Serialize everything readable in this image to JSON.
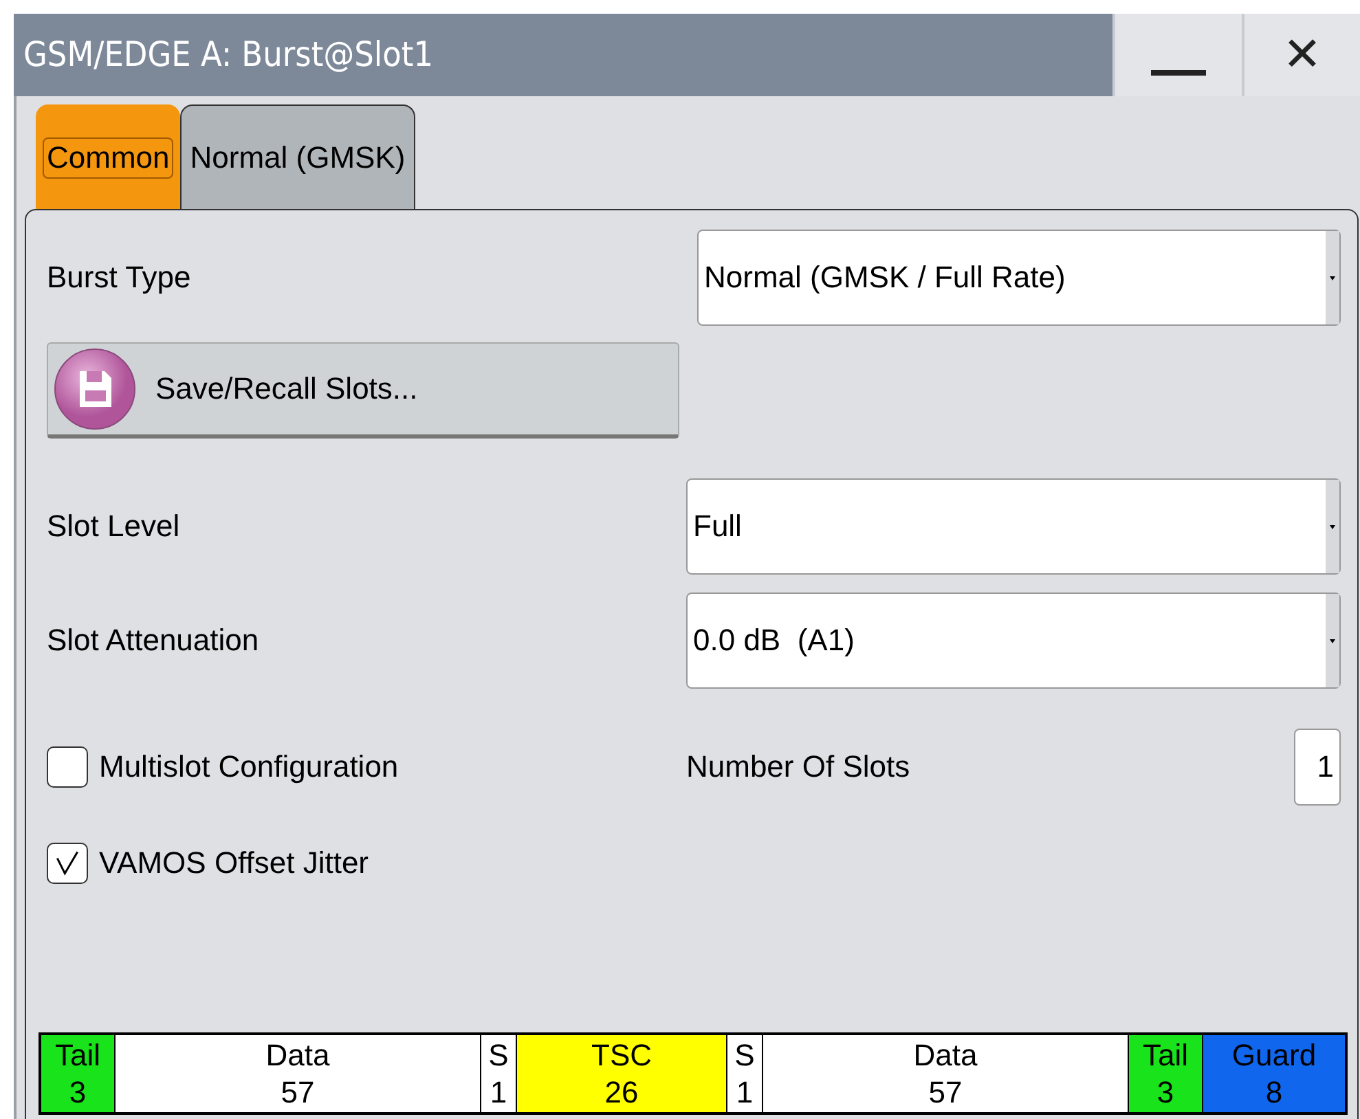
{
  "window": {
    "title": "GSM/EDGE A: Burst@Slot1",
    "controls": [
      {
        "kind": "minimize"
      },
      {
        "kind": "close",
        "label": "✕"
      }
    ]
  },
  "tabs": [
    {
      "label": "Common",
      "selected": true
    },
    {
      "label": "Normal (GMSK)",
      "selected": false
    }
  ],
  "burst_type": {
    "label": "Burst Type",
    "value": "Normal (GMSK / Full Rate)"
  },
  "save_button": {
    "label": "Save/Recall Slots..."
  },
  "slot_level": {
    "label": "Slot Level",
    "value": "Full"
  },
  "slot_attenuation": {
    "label": "Slot Attenuation",
    "value": "0.0 dB  (A1)"
  },
  "multislot": {
    "label": "Multislot Configuration",
    "checked": false
  },
  "number_of_slots": {
    "label": "Number Of Slots",
    "value": "1"
  },
  "vamos": {
    "label": "VAMOS Offset Jitter",
    "checked": true
  },
  "burst": [
    {
      "kind": "tail",
      "name": "Tail",
      "bits": "3"
    },
    {
      "kind": "data",
      "name": "Data",
      "bits": "57"
    },
    {
      "kind": "stealing",
      "name": "S",
      "bits": "1"
    },
    {
      "kind": "tsc",
      "name": "TSC",
      "bits": "26"
    },
    {
      "kind": "stealing",
      "name": "S",
      "bits": "1"
    },
    {
      "kind": "data",
      "name": "Data",
      "bits": "57"
    },
    {
      "kind": "tail",
      "name": "Tail",
      "bits": "3"
    },
    {
      "kind": "guard",
      "name": "Guard",
      "bits": "8"
    }
  ]
}
